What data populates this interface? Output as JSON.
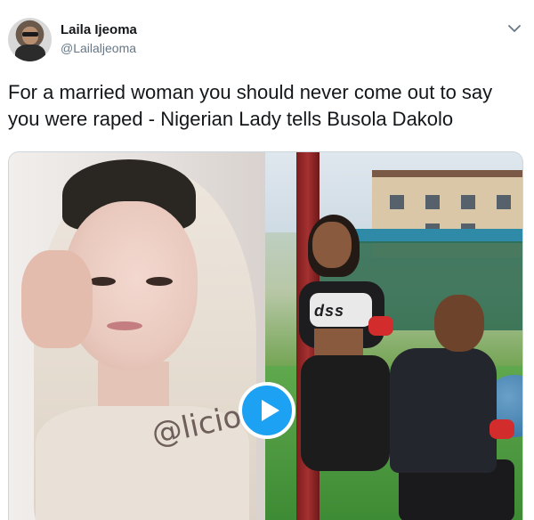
{
  "tweet": {
    "author_name": "Laila Ijeoma",
    "author_handle": "@Lailaljeoma",
    "text": "For a married woman you should never come out to say you were raped -  Nigerian Lady tells Busola Dakolo",
    "menu_icon": "chevron-down-icon",
    "accent_color": "#1da1f2"
  },
  "media": {
    "watermark": "@licio",
    "shirt_print": "dss",
    "play_icon": "play-icon"
  }
}
